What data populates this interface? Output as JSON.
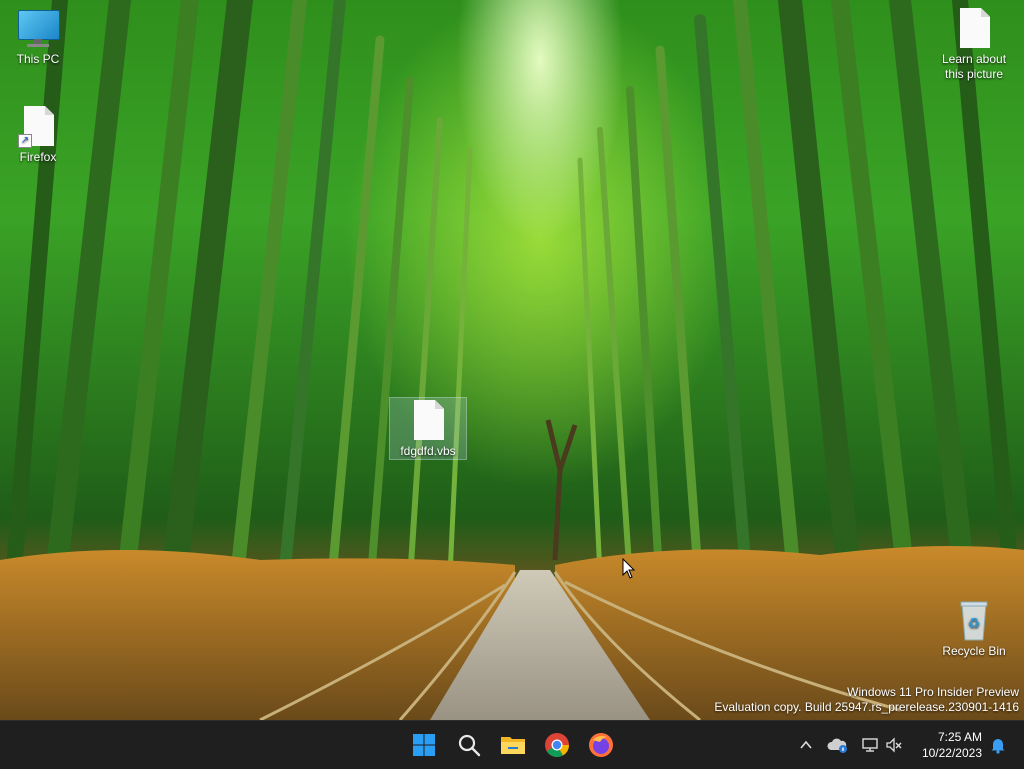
{
  "desktop": {
    "icons": [
      {
        "label": "This PC"
      },
      {
        "label": "Firefox"
      },
      {
        "label": "Learn about this picture"
      },
      {
        "label": "fdgdfd.vbs"
      },
      {
        "label": "Recycle Bin"
      }
    ],
    "watermark": {
      "line1": "Windows 11 Pro Insider Preview",
      "line2": "Evaluation copy. Build 25947.rs_prerelease.230901-1416"
    }
  },
  "taskbar": {
    "apps": [
      {
        "icon": "windows-start-icon"
      },
      {
        "icon": "search-icon"
      },
      {
        "icon": "file-explorer-icon"
      },
      {
        "icon": "chrome-icon"
      },
      {
        "icon": "firefox-icon"
      }
    ],
    "tray": {
      "time": "7:25 AM",
      "date": "10/22/2023",
      "icons": [
        "chevron-up-icon",
        "onedrive-icon",
        "network-icon",
        "volume-muted-icon",
        "notification-bell-icon"
      ]
    }
  },
  "colors": {
    "taskbar": "#1f1f1f",
    "windows_blue": "#1e90ff",
    "bamboo_green": "#3aa326"
  }
}
